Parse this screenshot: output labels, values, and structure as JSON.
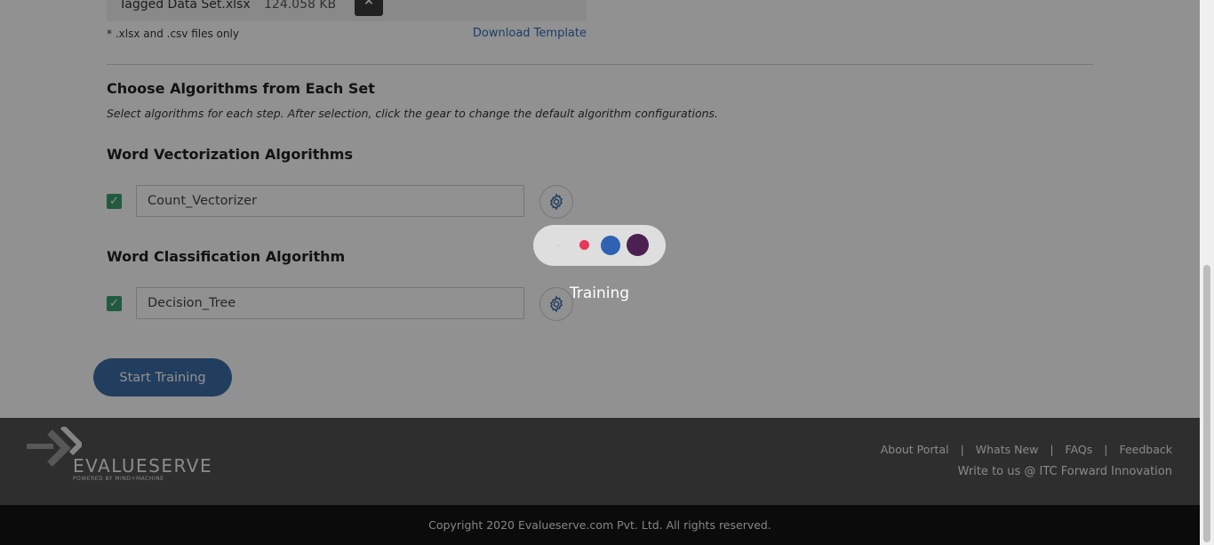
{
  "upload": {
    "file_name": "Tagged Data Set.xlsx",
    "file_size": "124.058 KB",
    "remove_symbol": "×",
    "note": "* .xlsx and .csv files only",
    "download_label": "Download Template"
  },
  "algorithms": {
    "title": "Choose Algorithms from Each Set",
    "description": "Select algorithms for each step. After selection, click the gear to change the default algorithm configurations.",
    "vectorization": {
      "title": "Word Vectorization Algorithms",
      "selected": "Count_Vectorizer",
      "checked": true
    },
    "classification": {
      "title": "Word Classification Algorithm",
      "selected": "Decision_Tree",
      "checked": true
    }
  },
  "actions": {
    "start_label": "Start Training"
  },
  "footer": {
    "brand": "EVALUESERVE",
    "brand_tagline": "POWERED BY MIND+MACHINE",
    "links": [
      "About Portal",
      "Whats New",
      "FAQs",
      "Feedback"
    ],
    "link_separator": "|",
    "write_us": "Write to us @ ITC Forward Innovation",
    "copyright": "Copyright 2020 Evalueserve.com Pvt. Ltd. All rights reserved."
  },
  "loader": {
    "label": "Training",
    "dot_colors": [
      "#c9c9c9",
      "#e8375a",
      "#2f62b0",
      "#4a2150"
    ]
  },
  "colors": {
    "accent_blue": "#3c6ea8",
    "link_blue": "#2f6db5",
    "check_green": "#3a9e6f",
    "footer_bg": "#525252",
    "copyright_bg": "#151515"
  },
  "icons": {
    "check": "check-icon",
    "gear": "gear-icon",
    "close": "close-icon",
    "logo": "evalueserve-logo-icon"
  }
}
